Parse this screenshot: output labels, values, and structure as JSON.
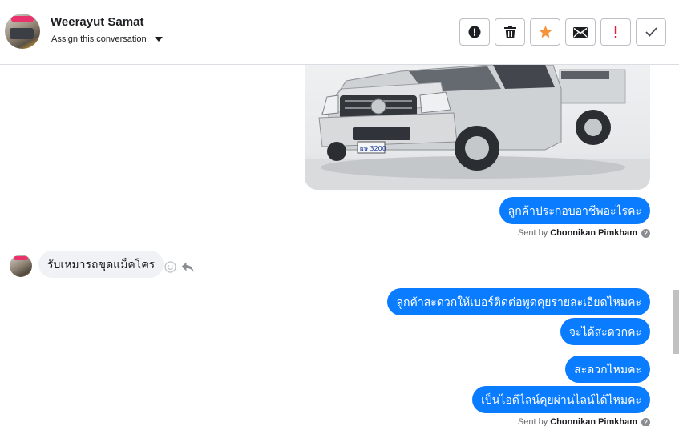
{
  "header": {
    "contact_name": "Weerayut Samat",
    "assign_label": "Assign this conversation"
  },
  "actions": [
    {
      "name": "spam-button",
      "icon": "exclamation-circle-icon"
    },
    {
      "name": "delete-button",
      "icon": "trash-icon"
    },
    {
      "name": "star-button",
      "icon": "star-icon",
      "color": "#f7923a"
    },
    {
      "name": "mark-unread-button",
      "icon": "envelope-icon"
    },
    {
      "name": "follow-up-button",
      "icon": "exclamation-icon",
      "color": "#e41e3f"
    },
    {
      "name": "done-button",
      "icon": "checkmark-icon"
    }
  ],
  "messages": {
    "out_1": "ลูกค้าประกอบอาชีพอะไรคะ",
    "sent_by_1": {
      "prefix": "Sent by",
      "agent": "Chonnikan Pimkham"
    },
    "in_1": "รับเหมารถขุดแม็คโคร",
    "out_2": "ลูกค้าสะดวกให้เบอร์ติดต่อพูดคุยรายละเอียดไหมคะ",
    "out_3": "จะได้สะดวกคะ",
    "out_4": "สะดวกไหมคะ",
    "out_5": "เป็นไอดีไลน์คุยผ่านไลน์ได้ไหมคะ",
    "sent_by_2": {
      "prefix": "Sent by",
      "agent": "Chonnikan Pimkham"
    }
  },
  "image": {
    "plate_text": "ผษ 3200",
    "description_icon": "pickup-truck-photo"
  },
  "colors": {
    "outgoing_bubble": "#0a7cff",
    "incoming_bubble": "#f0f2f5",
    "star": "#f7923a",
    "alert": "#e41e3f"
  }
}
